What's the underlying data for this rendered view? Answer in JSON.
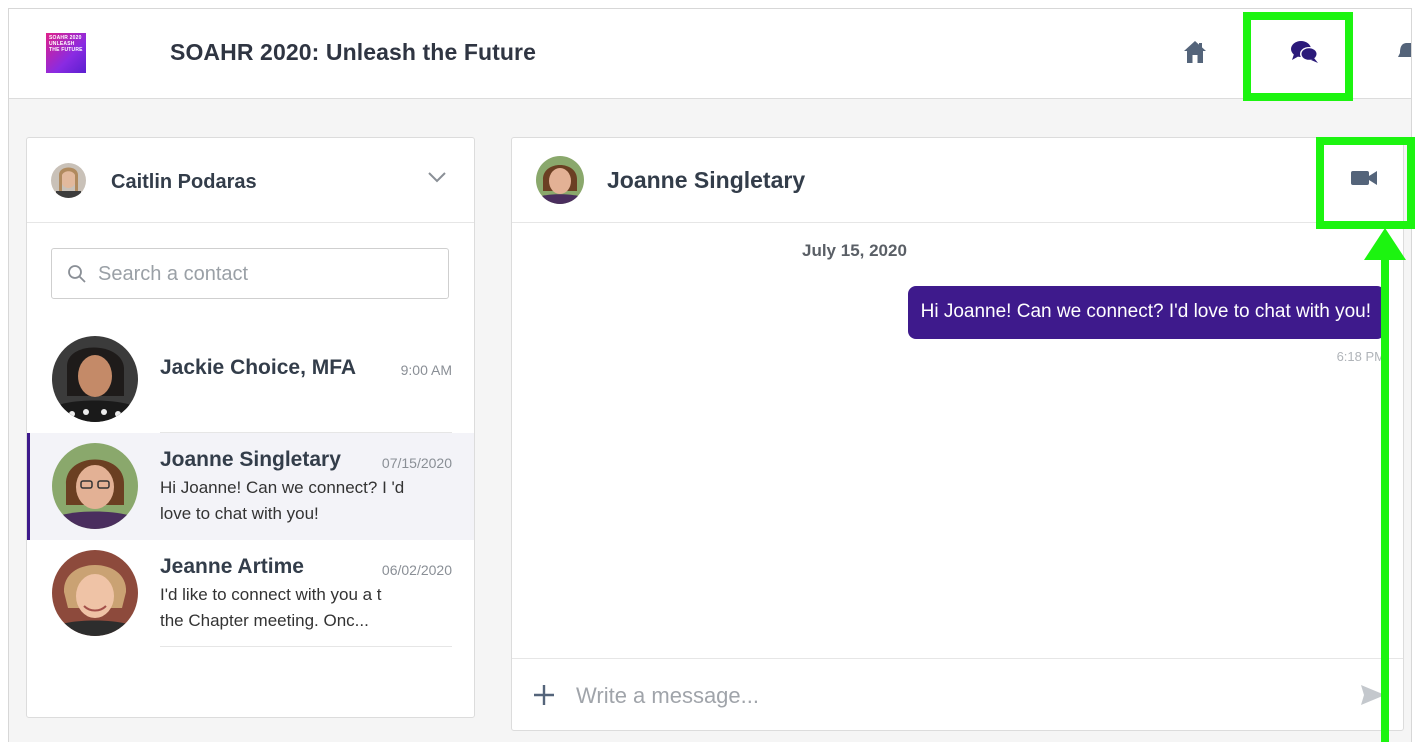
{
  "header": {
    "logo_text": "SOAHR 2020 UNLEASH THE FUTURE",
    "title": "SOAHR 2020: Unleash the Future",
    "nav": [
      {
        "name": "home-icon"
      },
      {
        "name": "chat-icon"
      },
      {
        "name": "bell-icon"
      }
    ]
  },
  "current_user": {
    "name": "Caitlin Podaras"
  },
  "search": {
    "placeholder": "Search a contact"
  },
  "contacts": [
    {
      "name": "Jackie Choice, MFA",
      "time": "9:00 AM",
      "preview": "",
      "active": false
    },
    {
      "name": "Joanne Singletary",
      "time": "07/15/2020",
      "preview": "Hi Joanne! Can we connect? I 'd love to chat with you!",
      "active": true
    },
    {
      "name": "Jeanne Artime",
      "time": "06/02/2020",
      "preview": "I'd like to connect with you a t the Chapter meeting. Onc...",
      "active": false
    }
  ],
  "chat": {
    "contact_name": "Joanne Singletary",
    "date_separator": "July 15, 2020",
    "messages": [
      {
        "text": "Hi Joanne! Can we connect? I'd love to chat with you!",
        "time": "6:18 PM",
        "outgoing": true
      }
    ],
    "composer_placeholder": "Write a message..."
  },
  "colors": {
    "accent": "#3e1a8c",
    "highlight": "#1cf410",
    "text_dark": "#333d4a"
  }
}
